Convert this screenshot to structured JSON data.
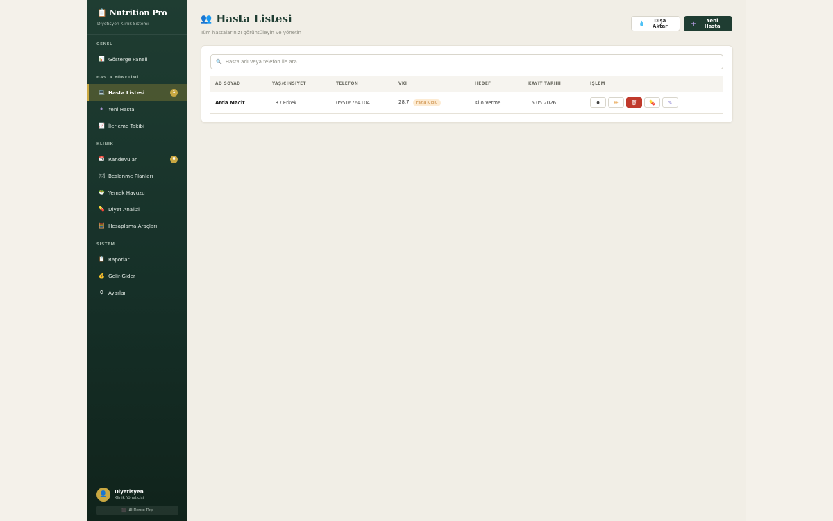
{
  "brand": {
    "title": "Nutrition Pro",
    "subtitle": "Diyetisyen Klinik Sistemi",
    "icon": "clipboard-icon"
  },
  "sidebar": {
    "sections": [
      {
        "label": "GENEL",
        "items": [
          {
            "label": "Gösterge Paneli",
            "icon": "chart-icon"
          }
        ]
      },
      {
        "label": "HASTA YÖNETİMİ",
        "items": [
          {
            "label": "Hasta Listesi",
            "icon": "laptop-icon",
            "active": true,
            "badge": "1"
          },
          {
            "label": "Yeni Hasta",
            "icon": "plus-icon"
          },
          {
            "label": "İlerleme Takibi",
            "icon": "trend-icon"
          }
        ]
      },
      {
        "label": "KLİNİK",
        "items": [
          {
            "label": "Randevular",
            "icon": "calendar-icon",
            "badge": "0"
          },
          {
            "label": "Beslenme Planları",
            "icon": "plate-icon"
          },
          {
            "label": "Yemek Havuzu",
            "icon": "bowl-icon"
          },
          {
            "label": "Diyet Analizi",
            "icon": "pill-icon"
          },
          {
            "label": "Hesaplama Araçları",
            "icon": "calculator-icon"
          }
        ]
      },
      {
        "label": "SİSTEM",
        "items": [
          {
            "label": "Raporlar",
            "icon": "report-icon"
          },
          {
            "label": "Gelir-Gider",
            "icon": "money-bag-icon"
          },
          {
            "label": "Ayarlar",
            "icon": "gear-icon"
          }
        ]
      }
    ]
  },
  "user": {
    "name": "Diyetisyen",
    "role": "Klinik Yöneticisi",
    "logout": "AI Devre Dışı"
  },
  "header": {
    "title": "Hasta Listesi",
    "subtitle": "Tüm hastalarınızı görüntüleyin ve yönetin",
    "export_label": "Dışa Aktar",
    "new_label": "Yeni Hasta"
  },
  "search": {
    "placeholder": "Hasta adı veya telefon ile ara..."
  },
  "table": {
    "columns": [
      "AD SOYAD",
      "YAŞ/CİNSİYET",
      "TELEFON",
      "VKİ",
      "HEDEF",
      "KAYIT TARİHİ",
      "İŞLEM"
    ],
    "rows": [
      {
        "name": "Arda Macit",
        "age_gender": "18 / Erkek",
        "phone": "05516764104",
        "bmi": "28.7",
        "bmi_tag": "Fazla Kilolu",
        "goal": "Kilo Verme",
        "date": "15.05.2026"
      }
    ]
  },
  "colors": {
    "sidebar": "#1f3d32",
    "accent": "#c9a842",
    "danger": "#c0392b",
    "bmi_tag": "#fdebd2"
  }
}
